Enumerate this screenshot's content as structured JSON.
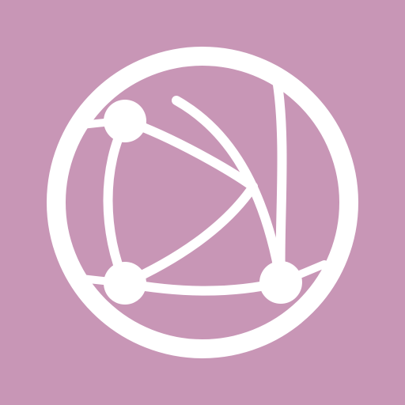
{
  "icon": {
    "name": "network-globe-icon",
    "background_color": "#c896b6",
    "foreground_color": "#ffffff"
  }
}
